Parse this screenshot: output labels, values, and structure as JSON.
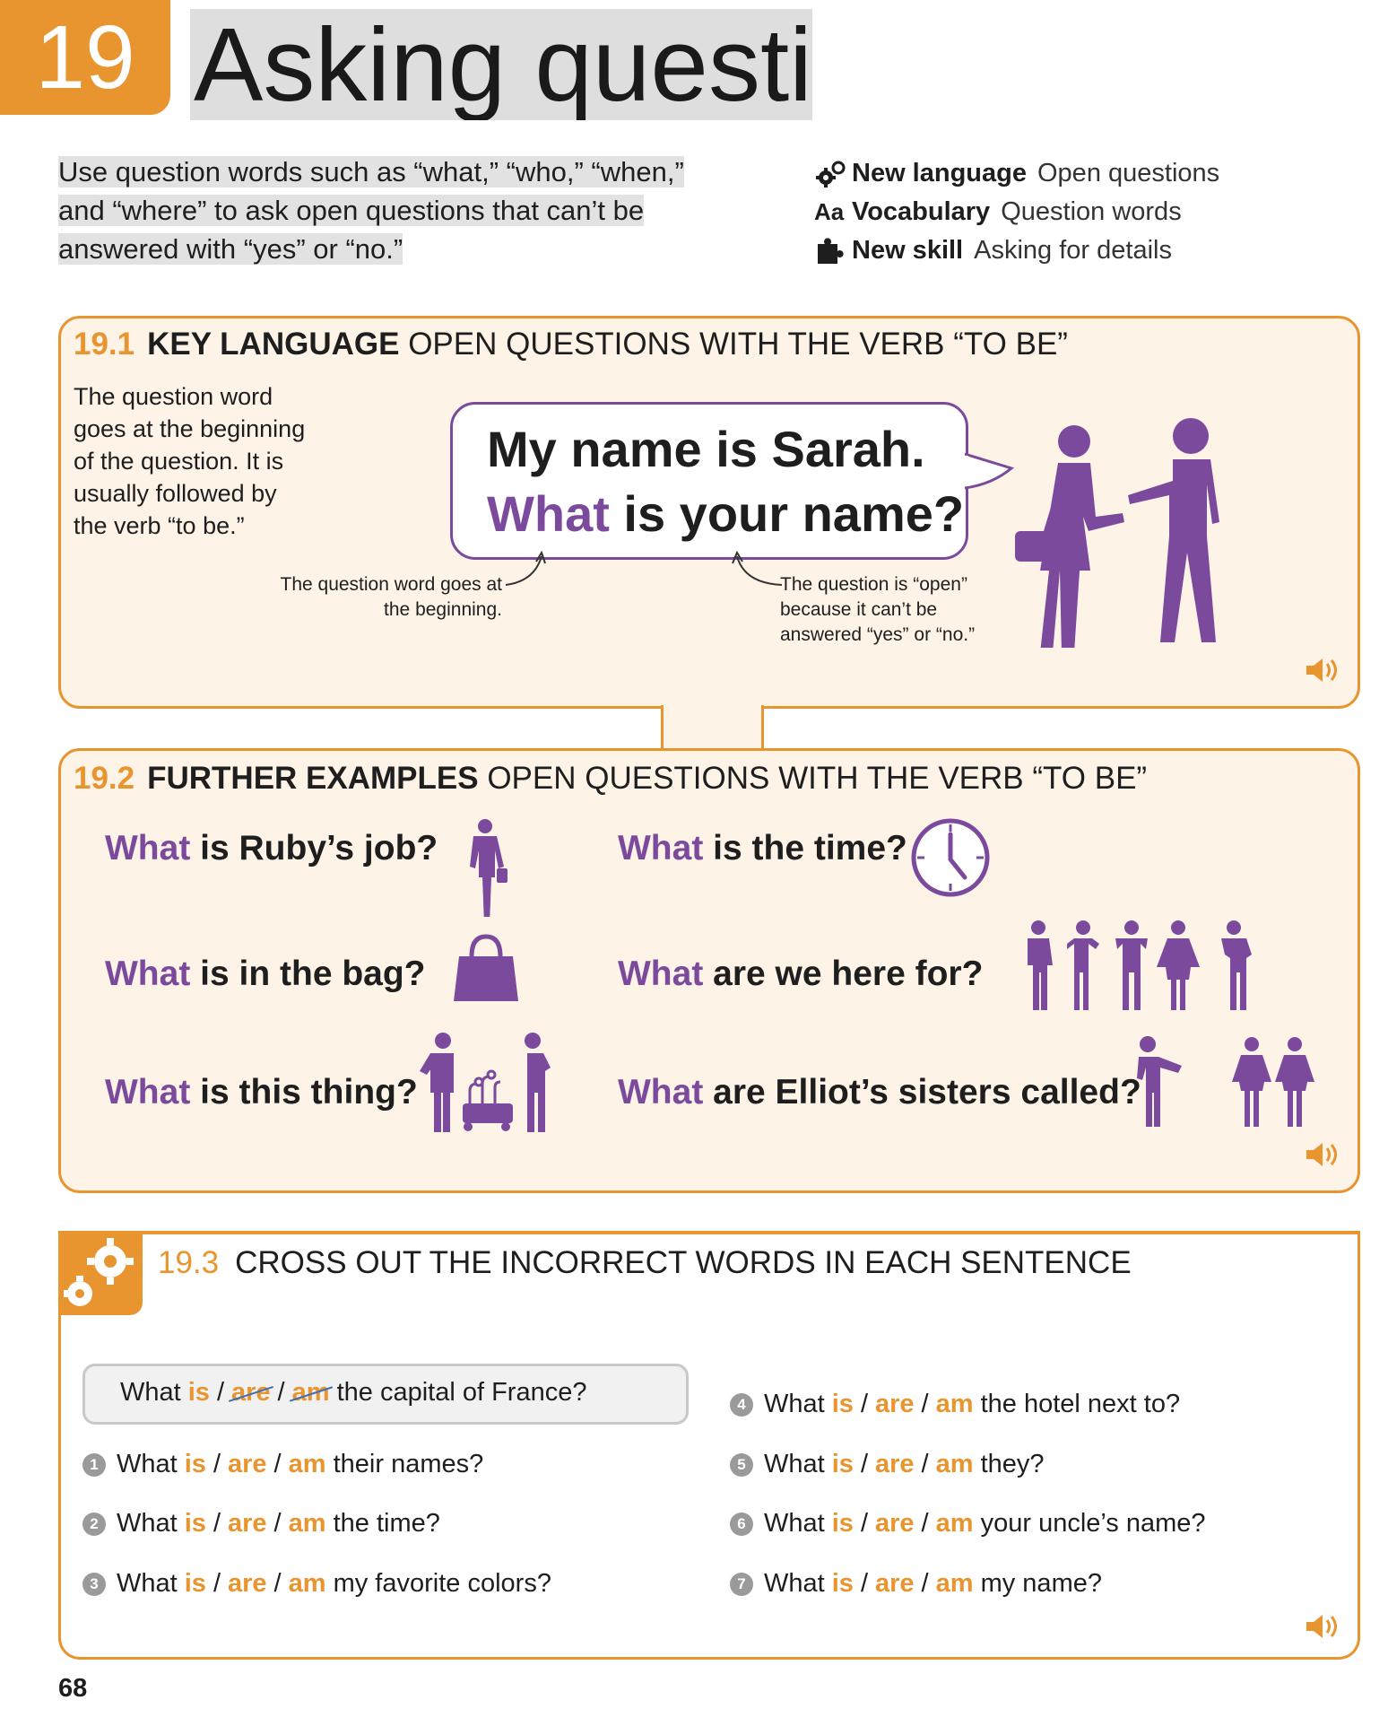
{
  "header": {
    "chapter_number": "19",
    "title": "Asking questions"
  },
  "intro": "Use question words such as “what,” “who,” “when,” and “where” to ask open questions that can’t be answered with “yes” or “no.”",
  "meta": [
    {
      "icon": "gears-icon",
      "key": "New language",
      "value": "Open questions"
    },
    {
      "icon": "aa-icon",
      "key": "Vocabulary",
      "value": "Question words"
    },
    {
      "icon": "puzzle-icon",
      "key": "New skill",
      "value": "Asking for details"
    }
  ],
  "section1": {
    "number": "19.1",
    "keyword": "KEY LANGUAGE",
    "heading": "OPEN QUESTIONS WITH THE VERB “TO BE”",
    "explanation": "The question word goes at the beginning of the question. It is usually followed by the verb “to be.”",
    "bubble_line1": "My name is Sarah.",
    "bubble_qword": "What",
    "bubble_line2_rest": " is your name?",
    "note_left": "The question word goes at the beginning.",
    "note_right": "The question is “open” because it can’t be answered “yes” or “no.”"
  },
  "section2": {
    "number": "19.2",
    "keyword": "FURTHER EXAMPLES",
    "heading": "OPEN QUESTIONS WITH THE VERB “TO BE”",
    "questions": [
      {
        "qword": "What",
        "rest": " is Ruby’s job?"
      },
      {
        "qword": "What",
        "rest": " is the time?"
      },
      {
        "qword": "What",
        "rest": " is in the bag?"
      },
      {
        "qword": "What",
        "rest": " are we here for?"
      },
      {
        "qword": "What",
        "rest": " is this thing?"
      },
      {
        "qword": "What",
        "rest": " are Elliot’s sisters called?"
      }
    ]
  },
  "section3": {
    "number": "19.3",
    "heading": "CROSS OUT THE INCORRECT WORDS IN EACH SENTENCE",
    "options": [
      "is",
      "are",
      "am"
    ],
    "example": {
      "start": "What",
      "end": "the capital of France?"
    },
    "items": [
      {
        "n": "1",
        "start": "What",
        "end": "their names?"
      },
      {
        "n": "2",
        "start": "What",
        "end": "the time?"
      },
      {
        "n": "3",
        "start": "What",
        "end": "my favorite colors?"
      },
      {
        "n": "4",
        "start": "What",
        "end": "the hotel next to?"
      },
      {
        "n": "5",
        "start": "What",
        "end": "they?"
      },
      {
        "n": "6",
        "start": "What",
        "end": "your uncle’s name?"
      },
      {
        "n": "7",
        "start": "What",
        "end": "my name?"
      }
    ]
  },
  "page_number": "68",
  "colors": {
    "accent": "#e8952f",
    "purple": "#7c4a9c",
    "panel_bg": "#fdf3e7"
  }
}
